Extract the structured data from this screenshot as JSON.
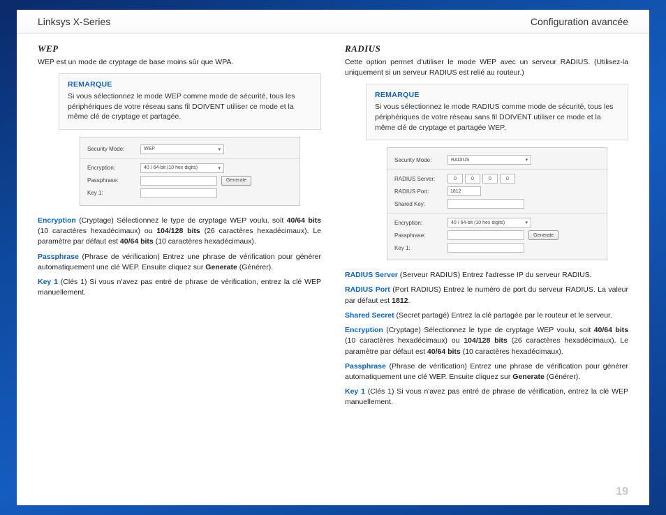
{
  "header": {
    "left": "Linksys X-Series",
    "right": "Configuration avancée"
  },
  "pageNumber": "19",
  "left": {
    "title": "Wep",
    "intro": "WEP est un mode de cryptage de base moins sûr que WPA.",
    "note": {
      "title": "REMARQUE",
      "body": "Si vous sélectionnez le mode WEP comme mode de sécurité, tous les périphériques de votre réseau sans fil DOIVENT utiliser ce mode et la même clé de cryptage et partagée."
    },
    "shot": {
      "securityModeLabel": "Security Mode:",
      "securityModeValue": "WEP",
      "encryptionLabel": "Encryption:",
      "encryptionValue": "40 / 64-bit (10 hex digits)",
      "passphraseLabel": "Passphrase:",
      "key1Label": "Key 1:",
      "generate": "Generate"
    },
    "encryption": {
      "term": "Encryption",
      "text1": " (Cryptage)  Sélectionnez le type de cryptage WEP voulu, soit ",
      "bold1": "40/64 bits",
      "text2": " (10 caractères hexadécimaux) ou ",
      "bold2": "104/128 bits",
      "text3": " (26 caractères hexadécimaux). Le paramètre par défaut est ",
      "bold3": "40/64 bits",
      "text4": " (10 caractères hexadécimaux)."
    },
    "passphrase": {
      "term": "Passphrase",
      "text1": " (Phrase de vérification)  Entrez une phrase de vérification pour générer automatiquement une clé WEP. Ensuite cliquez sur ",
      "bold1": "Generate",
      "text2": " (Générer)."
    },
    "key1": {
      "term": "Key 1",
      "text": " (Clés 1)  Si vous n'avez pas entré de phrase de vérification, entrez la clé WEP manuellement."
    }
  },
  "right": {
    "title": "Radius",
    "intro": "Cette option permet d'utiliser le mode WEP avec un serveur RADIUS. (Utilisez-la uniquement si un serveur RADIUS est relié au routeur.)",
    "note": {
      "title": "REMARQUE",
      "body": "Si vous sélectionnez le mode RADIUS comme mode de sécurité, tous les périphériques de votre réseau sans fil DOIVENT utiliser ce mode et la même clé de cryptage et partagée WEP."
    },
    "shot": {
      "securityModeLabel": "Security Mode:",
      "securityModeValue": "RADIUS",
      "radiusServerLabel": "RADIUS Server:",
      "ip": [
        "0",
        "0",
        "0",
        "0"
      ],
      "radiusPortLabel": "RADIUS Port:",
      "radiusPortValue": "1812",
      "sharedKeyLabel": "Shared Key:",
      "encryptionLabel": "Encryption:",
      "encryptionValue": "40 / 64-bit (10 hex digits)",
      "passphraseLabel": "Passphrase:",
      "key1Label": "Key 1:",
      "generate": "Generate"
    },
    "radiusServer": {
      "term": "RADIUS Server",
      "text": " (Serveur RADIUS)  Entrez l'adresse IP du serveur RADIUS."
    },
    "radiusPort": {
      "term": "RADIUS Port",
      "text1": " (Port RADIUS)   Entrez le numéro de port du serveur RADIUS. La valeur par défaut est ",
      "bold1": "1812",
      "text2": "."
    },
    "sharedSecret": {
      "term": "Shared Secret",
      "text": " (Secret partagé)  Entrez la clé partagée par le routeur et le serveur."
    },
    "encryption": {
      "term": "Encryption",
      "text1": " (Cryptage)  Sélectionnez le type de cryptage WEP voulu, soit ",
      "bold1": "40/64 bits",
      "text2": " (10 caractères hexadécimaux) ou ",
      "bold2": "104/128 bits",
      "text3": " (26 caractères hexadécimaux). Le paramètre par défaut est ",
      "bold3": "40/64 bits",
      "text4": " (10 caractères hexadécimaux)."
    },
    "passphrase": {
      "term": "Passphrase",
      "text1": " (Phrase de vérification)  Entrez une phrase de vérification pour générer automatiquement une clé WEP. Ensuite cliquez sur ",
      "bold1": "Generate",
      "text2": " (Générer)."
    },
    "key1": {
      "term": "Key 1",
      "text": " (Clés 1)  Si vous n'avez pas entré de phrase de vérification, entrez la clé WEP manuellement."
    }
  }
}
